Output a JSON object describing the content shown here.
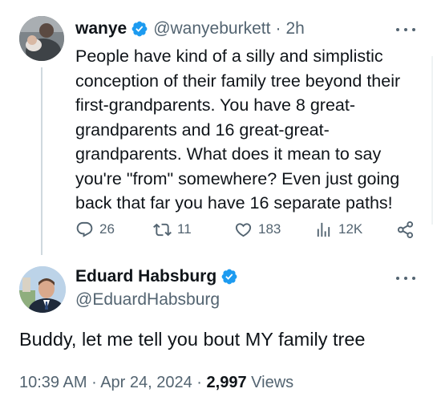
{
  "tweet1": {
    "display_name": "wanye",
    "handle": "@wanyeburkett",
    "separator": "·",
    "time": "2h",
    "text": "People have kind of a silly and simplistic\nconception of their family tree beyond their\nfirst-grandparents. You have 8 great-\ngrandparents and 16 great-great-\ngrandparents. What does it mean to say\nyou're \"from\" somewhere? Even just going\nback that far you have 16 separate paths!",
    "replies": "26",
    "reposts": "11",
    "likes": "183",
    "views": "12K"
  },
  "tweet2": {
    "display_name": "Eduard Habsburg",
    "handle": "@EduardHabsburg",
    "text": "Buddy, let me tell you bout MY family tree",
    "time": "10:39 AM",
    "separator": "·",
    "date": "Apr 24, 2024",
    "separator2": "·",
    "views_count": "2,997",
    "views_label": "Views"
  },
  "colors": {
    "verified_blue": "#1d9bf0",
    "muted_text": "#536471",
    "primary_text": "#0f1419",
    "thread_line": "#cfd9de"
  },
  "icons": [
    "verified-badge-icon",
    "more-icon",
    "reply-icon",
    "repost-icon",
    "like-icon",
    "views-icon",
    "share-icon"
  ]
}
